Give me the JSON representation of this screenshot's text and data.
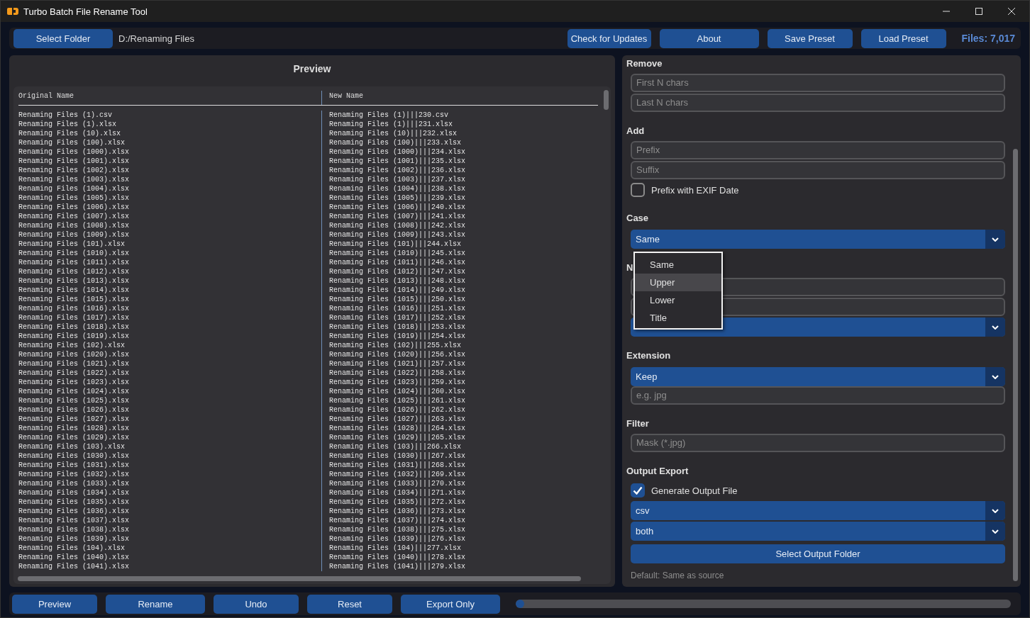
{
  "window": {
    "title": "Turbo Batch File Rename Tool"
  },
  "toolbar": {
    "select_folder": "Select Folder",
    "folder_path": "D:/Renaming Files",
    "buttons": [
      "Check for Updates",
      "About",
      "Save Preset",
      "Load Preset"
    ],
    "files_count": "Files: 7,017"
  },
  "preview": {
    "title": "Preview",
    "columns": [
      "Original Name",
      "New Name"
    ],
    "rows": [
      {
        "original": "Renaming Files (1).csv",
        "new": "Renaming Files (1)|||230.csv"
      },
      {
        "original": "Renaming Files (1).xlsx",
        "new": "Renaming Files (1)|||231.xlsx"
      },
      {
        "original": "Renaming Files (10).xlsx",
        "new": "Renaming Files (10)|||232.xlsx"
      },
      {
        "original": "Renaming Files (100).xlsx",
        "new": "Renaming Files (100)|||233.xlsx"
      },
      {
        "original": "Renaming Files (1000).xlsx",
        "new": "Renaming Files (1000)|||234.xlsx"
      },
      {
        "original": "Renaming Files (1001).xlsx",
        "new": "Renaming Files (1001)|||235.xlsx"
      },
      {
        "original": "Renaming Files (1002).xlsx",
        "new": "Renaming Files (1002)|||236.xlsx"
      },
      {
        "original": "Renaming Files (1003).xlsx",
        "new": "Renaming Files (1003)|||237.xlsx"
      },
      {
        "original": "Renaming Files (1004).xlsx",
        "new": "Renaming Files (1004)|||238.xlsx"
      },
      {
        "original": "Renaming Files (1005).xlsx",
        "new": "Renaming Files (1005)|||239.xlsx"
      },
      {
        "original": "Renaming Files (1006).xlsx",
        "new": "Renaming Files (1006)|||240.xlsx"
      },
      {
        "original": "Renaming Files (1007).xlsx",
        "new": "Renaming Files (1007)|||241.xlsx"
      },
      {
        "original": "Renaming Files (1008).xlsx",
        "new": "Renaming Files (1008)|||242.xlsx"
      },
      {
        "original": "Renaming Files (1009).xlsx",
        "new": "Renaming Files (1009)|||243.xlsx"
      },
      {
        "original": "Renaming Files (101).xlsx",
        "new": "Renaming Files (101)|||244.xlsx"
      },
      {
        "original": "Renaming Files (1010).xlsx",
        "new": "Renaming Files (1010)|||245.xlsx"
      },
      {
        "original": "Renaming Files (1011).xlsx",
        "new": "Renaming Files (1011)|||246.xlsx"
      },
      {
        "original": "Renaming Files (1012).xlsx",
        "new": "Renaming Files (1012)|||247.xlsx"
      },
      {
        "original": "Renaming Files (1013).xlsx",
        "new": "Renaming Files (1013)|||248.xlsx"
      },
      {
        "original": "Renaming Files (1014).xlsx",
        "new": "Renaming Files (1014)|||249.xlsx"
      },
      {
        "original": "Renaming Files (1015).xlsx",
        "new": "Renaming Files (1015)|||250.xlsx"
      },
      {
        "original": "Renaming Files (1016).xlsx",
        "new": "Renaming Files (1016)|||251.xlsx"
      },
      {
        "original": "Renaming Files (1017).xlsx",
        "new": "Renaming Files (1017)|||252.xlsx"
      },
      {
        "original": "Renaming Files (1018).xlsx",
        "new": "Renaming Files (1018)|||253.xlsx"
      },
      {
        "original": "Renaming Files (1019).xlsx",
        "new": "Renaming Files (1019)|||254.xlsx"
      },
      {
        "original": "Renaming Files (102).xlsx",
        "new": "Renaming Files (102)|||255.xlsx"
      },
      {
        "original": "Renaming Files (1020).xlsx",
        "new": "Renaming Files (1020)|||256.xlsx"
      },
      {
        "original": "Renaming Files (1021).xlsx",
        "new": "Renaming Files (1021)|||257.xlsx"
      },
      {
        "original": "Renaming Files (1022).xlsx",
        "new": "Renaming Files (1022)|||258.xlsx"
      },
      {
        "original": "Renaming Files (1023).xlsx",
        "new": "Renaming Files (1023)|||259.xlsx"
      },
      {
        "original": "Renaming Files (1024).xlsx",
        "new": "Renaming Files (1024)|||260.xlsx"
      },
      {
        "original": "Renaming Files (1025).xlsx",
        "new": "Renaming Files (1025)|||261.xlsx"
      },
      {
        "original": "Renaming Files (1026).xlsx",
        "new": "Renaming Files (1026)|||262.xlsx"
      },
      {
        "original": "Renaming Files (1027).xlsx",
        "new": "Renaming Files (1027)|||263.xlsx"
      },
      {
        "original": "Renaming Files (1028).xlsx",
        "new": "Renaming Files (1028)|||264.xlsx"
      },
      {
        "original": "Renaming Files (1029).xlsx",
        "new": "Renaming Files (1029)|||265.xlsx"
      },
      {
        "original": "Renaming Files (103).xlsx",
        "new": "Renaming Files (103)|||266.xlsx"
      },
      {
        "original": "Renaming Files (1030).xlsx",
        "new": "Renaming Files (1030)|||267.xlsx"
      },
      {
        "original": "Renaming Files (1031).xlsx",
        "new": "Renaming Files (1031)|||268.xlsx"
      },
      {
        "original": "Renaming Files (1032).xlsx",
        "new": "Renaming Files (1032)|||269.xlsx"
      },
      {
        "original": "Renaming Files (1033).xlsx",
        "new": "Renaming Files (1033)|||270.xlsx"
      },
      {
        "original": "Renaming Files (1034).xlsx",
        "new": "Renaming Files (1034)|||271.xlsx"
      },
      {
        "original": "Renaming Files (1035).xlsx",
        "new": "Renaming Files (1035)|||272.xlsx"
      },
      {
        "original": "Renaming Files (1036).xlsx",
        "new": "Renaming Files (1036)|||273.xlsx"
      },
      {
        "original": "Renaming Files (1037).xlsx",
        "new": "Renaming Files (1037)|||274.xlsx"
      },
      {
        "original": "Renaming Files (1038).xlsx",
        "new": "Renaming Files (1038)|||275.xlsx"
      },
      {
        "original": "Renaming Files (1039).xlsx",
        "new": "Renaming Files (1039)|||276.xlsx"
      },
      {
        "original": "Renaming Files (104).xlsx",
        "new": "Renaming Files (104)|||277.xlsx"
      },
      {
        "original": "Renaming Files (1040).xlsx",
        "new": "Renaming Files (1040)|||278.xlsx"
      },
      {
        "original": "Renaming Files (1041).xlsx",
        "new": "Renaming Files (1041)|||279.xlsx"
      }
    ]
  },
  "settings": [
    {
      "title": "Remove",
      "items": [
        {
          "kind": "input",
          "placeholder": "First N chars"
        },
        {
          "kind": "input",
          "placeholder": "Last N chars"
        }
      ]
    },
    {
      "title": "Add",
      "items": [
        {
          "kind": "input",
          "placeholder": "Prefix"
        },
        {
          "kind": "input",
          "placeholder": "Suffix"
        },
        {
          "kind": "checkbox",
          "label": "Prefix with EXIF Date",
          "checked": false
        }
      ]
    },
    {
      "title": "Case",
      "items": [
        {
          "kind": "select",
          "value": "Same"
        }
      ]
    },
    {
      "title": "N",
      "items": [
        {
          "kind": "input"
        },
        {
          "kind": "input"
        },
        {
          "kind": "select"
        }
      ]
    },
    {
      "title": "Extension",
      "items": [
        {
          "kind": "select",
          "value": "Keep"
        },
        {
          "kind": "input",
          "placeholder": "e.g. jpg"
        }
      ]
    },
    {
      "title": "Filter",
      "items": [
        {
          "kind": "input",
          "placeholder": "Mask (*.jpg)"
        }
      ]
    },
    {
      "title": "Output Export",
      "items": [
        {
          "kind": "checkbox",
          "label": "Generate Output File",
          "checked": true
        },
        {
          "kind": "select",
          "value": "csv"
        },
        {
          "kind": "select",
          "value": "both"
        },
        {
          "kind": "button",
          "label": "Select Output Folder"
        },
        {
          "kind": "note",
          "text": "Default: Same as source"
        }
      ]
    }
  ],
  "case_menu": [
    {
      "label": "Same",
      "selected": false
    },
    {
      "label": "Upper",
      "selected": true
    },
    {
      "label": "Lower",
      "selected": false
    },
    {
      "label": "Title",
      "selected": false
    }
  ],
  "bottom_buttons": [
    "Preview",
    "Rename",
    "Undo",
    "Reset",
    "Export Only"
  ],
  "progress": {
    "level": 0.01
  }
}
